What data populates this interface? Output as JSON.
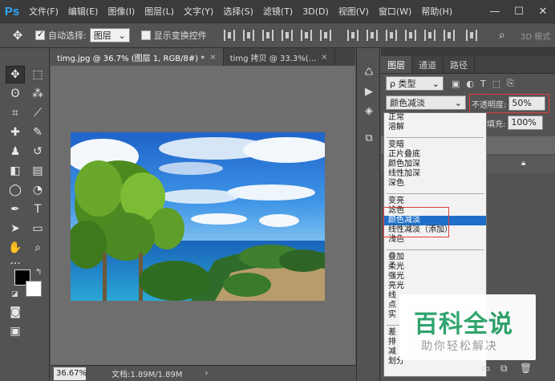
{
  "app": {
    "logo": "Ps"
  },
  "menu": [
    "文件(F)",
    "编辑(E)",
    "图像(I)",
    "图层(L)",
    "文字(Y)",
    "选择(S)",
    "滤镜(T)",
    "3D(D)",
    "视图(V)",
    "窗口(W)",
    "帮助(H)"
  ],
  "window_controls": {
    "minimize": "—",
    "maximize": "☐",
    "close": "✕"
  },
  "options": {
    "auto_select_label": "自动选择:",
    "auto_select_value": "图层",
    "show_transform_label": "显示变换控件",
    "mode_3d": "3D 模式"
  },
  "tabs": [
    {
      "label": "timg.jpg @ 36.7% (图层 1, RGB/8#) *",
      "close": "×"
    },
    {
      "label": "timg 拷贝 @ 33.3%(...",
      "close": "×"
    }
  ],
  "status": {
    "zoom": "36.67%",
    "doc": "文档:1.89M/1.89M"
  },
  "layers_panel": {
    "tabs": [
      "图层",
      "通道",
      "路径"
    ],
    "filter_label": "ρ 类型",
    "blend_value": "颜色减淡",
    "opacity_label": "不透明度:",
    "opacity_value": "50%",
    "fill_label": "填充:",
    "fill_value": "100%"
  },
  "blend_modes": {
    "group1": [
      "正常",
      "溶解"
    ],
    "group2": [
      "变暗",
      "正片叠底",
      "颜色加深",
      "线性加深",
      "深色"
    ],
    "group3": [
      "变亮",
      "滤色",
      "颜色减淡",
      "线性减淡（添加）",
      "浅色"
    ],
    "group4": [
      "叠加",
      "柔光",
      "强光",
      "亮光",
      "线",
      "点",
      "实"
    ],
    "group5": [
      "差",
      "排",
      "减",
      "划分"
    ],
    "selected": "颜色减淡"
  },
  "watermark": {
    "title": "百科全说",
    "subtitle": "助你轻松解决"
  },
  "colors": {
    "accent": "#1e6fc8",
    "highlight_box": "#e0403a",
    "watermark_green": "#2aa36a"
  }
}
